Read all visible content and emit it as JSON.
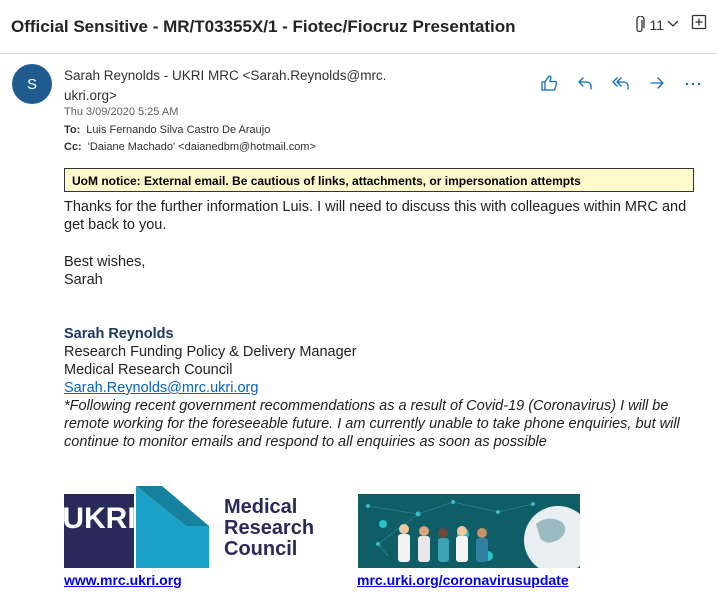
{
  "email": {
    "subject": "Official Sensitive - MR/T03355X/1 - Fiotec/Fiocruz Presentation",
    "attachment_count": "11",
    "avatar_initial": "S",
    "sender_line1": "Sarah Reynolds - UKRI MRC <Sarah.Reynolds@mrc.",
    "sender_line2": "ukri.org>",
    "date": "Thu 3/09/2020 5:25 AM",
    "to_label": "To:",
    "to": "Luis Fernando Silva Castro De Araujo",
    "cc_label": "Cc:",
    "cc": "'Daiane Machado' <daianedbm@hotmail.com>",
    "external_notice": "UoM notice: External email. Be cautious of links, attachments, or impersonation attempts"
  },
  "actions": [
    "like-icon",
    "reply-icon",
    "reply-all-icon",
    "forward-icon",
    "more-icon"
  ],
  "body": {
    "paragraph1": "Thanks for the further information Luis.  I will need to discuss this with colleagues within MRC and get back to you.",
    "closing1": "Best wishes,",
    "closing2": "Sarah"
  },
  "signature": {
    "name": "Sarah Reynolds",
    "role": "Research Funding Policy & Delivery Manager",
    "organization": "Medical Research Council",
    "email": "Sarah.Reynolds@mrc.ukri.org",
    "covid_notice": "*Following recent government recommendations as a result of Covid-19 (Coronavirus) I will be remote working for the foreseeable future. I am currently unable to take phone enquiries, but will continue to monitor emails and respond to all enquiries as soon as possible"
  },
  "logos": {
    "ukri_text": "UKRI",
    "mrc_line1": "Medical",
    "mrc_line2": "Research",
    "mrc_line3": "Council",
    "link1": "www.mrc.ukri.org",
    "link2": "mrc.urki.org/coronavirusupdate"
  },
  "colors": {
    "avatar_bg": "#1f5b8f",
    "notice_bg": "#fff9cc",
    "signature_name": "#1f3864",
    "link": "#0563c1",
    "action_icons": "#0f6cbd"
  }
}
